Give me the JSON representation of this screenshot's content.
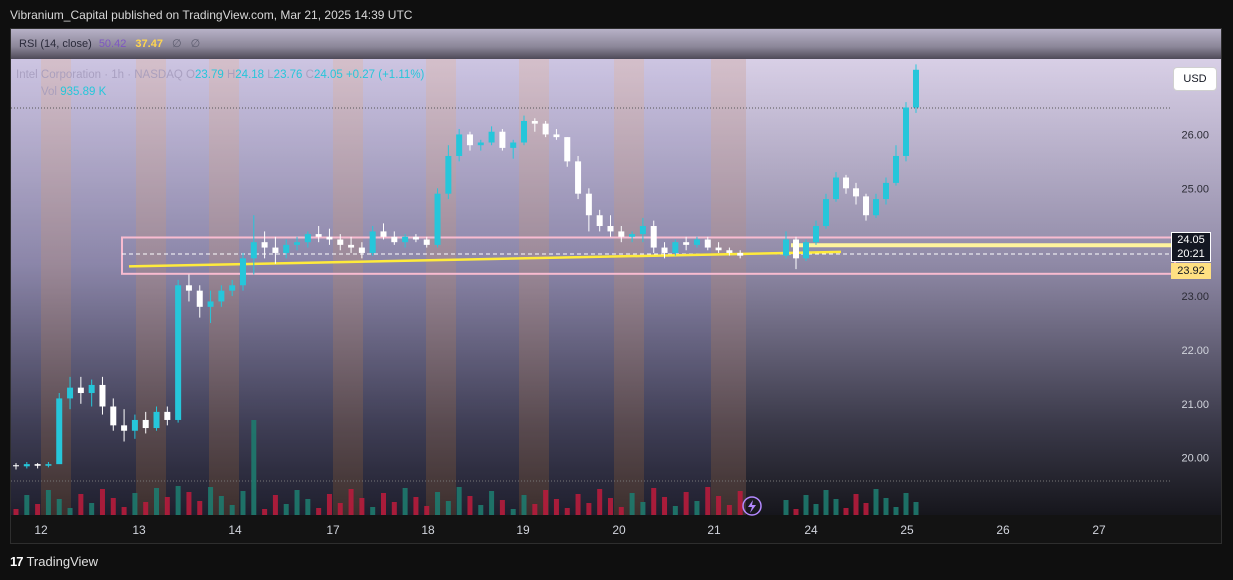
{
  "header": {
    "publisher_line": "Vibranium_Capital published on TradingView.com, Mar 21, 2025 14:39 UTC"
  },
  "rsi": {
    "name": "RSI (14, close)",
    "value1": "50.42",
    "value2": "37.47",
    "value3": "∅",
    "value4": "∅"
  },
  "legend": {
    "symbol": "Intel Corporation · 1h · NASDAQ",
    "o_label": "O",
    "o": "23.79",
    "h_label": "H",
    "h": "24.18",
    "l_label": "L",
    "l": "23.76",
    "c_label": "C",
    "c": "24.05",
    "change": "+0.27 (+1.11%)",
    "volume_label": "Vol",
    "volume": "935.89 K"
  },
  "currency_button": "USD",
  "badges": {
    "price": "24.05",
    "timer": "20:21",
    "level": "23.92"
  },
  "footer": {
    "brand": "TradingView",
    "logo": "17"
  },
  "colors": {
    "up": "#26c6da",
    "down": "#ffffff",
    "yellow": "#ffeb3b",
    "box": "#f8bbd0",
    "vol_up": "#1e7a6e",
    "vol_down": "#b71c3c"
  },
  "chart_data": {
    "type": "candlestick",
    "title": "Intel Corporation · 1h · NASDAQ",
    "y_ticks": [
      20.0,
      21.0,
      22.0,
      23.0,
      24.0,
      25.0,
      26.0
    ],
    "ylim": [
      19.4,
      27.4
    ],
    "x_ticks": [
      "12",
      "13",
      "14",
      "17",
      "18",
      "19",
      "20",
      "21",
      "24",
      "25",
      "26",
      "27"
    ],
    "last_price": 24.05,
    "levels": [
      24.05,
      23.92
    ],
    "candles": [
      [
        19.86,
        19.9,
        19.78,
        19.84
      ],
      [
        19.84,
        19.92,
        19.8,
        19.88
      ],
      [
        19.88,
        19.9,
        19.8,
        19.85
      ],
      [
        19.85,
        19.92,
        19.82,
        19.88
      ],
      [
        19.88,
        21.2,
        20.65,
        21.1
      ],
      [
        21.1,
        21.5,
        20.9,
        21.3
      ],
      [
        21.3,
        21.5,
        21.0,
        21.2
      ],
      [
        21.2,
        21.45,
        20.95,
        21.35
      ],
      [
        21.35,
        21.5,
        20.8,
        20.95
      ],
      [
        20.95,
        21.1,
        20.5,
        20.6
      ],
      [
        20.6,
        20.9,
        20.3,
        20.5
      ],
      [
        20.5,
        20.8,
        20.35,
        20.7
      ],
      [
        20.7,
        20.85,
        20.45,
        20.55
      ],
      [
        20.55,
        20.95,
        20.5,
        20.85
      ],
      [
        20.85,
        20.95,
        20.6,
        20.7
      ],
      [
        20.7,
        23.3,
        20.65,
        23.2
      ],
      [
        23.2,
        23.4,
        22.9,
        23.1
      ],
      [
        23.1,
        23.2,
        22.6,
        22.8
      ],
      [
        22.8,
        23.1,
        22.5,
        22.9
      ],
      [
        22.9,
        23.2,
        22.8,
        23.1
      ],
      [
        23.1,
        23.3,
        23.0,
        23.2
      ],
      [
        23.2,
        23.8,
        23.1,
        23.7
      ],
      [
        23.7,
        24.5,
        23.4,
        24.0
      ],
      [
        24.0,
        24.2,
        23.7,
        23.9
      ],
      [
        23.9,
        24.1,
        23.6,
        23.8
      ],
      [
        23.8,
        24.05,
        23.7,
        23.95
      ],
      [
        23.95,
        24.1,
        23.85,
        24.0
      ],
      [
        24.0,
        24.2,
        23.9,
        24.15
      ],
      [
        24.15,
        24.3,
        24.0,
        24.1
      ],
      [
        24.1,
        24.25,
        23.95,
        24.05
      ],
      [
        24.05,
        24.15,
        23.85,
        23.95
      ],
      [
        23.95,
        24.1,
        23.8,
        23.9
      ],
      [
        23.9,
        24.0,
        23.7,
        23.8
      ],
      [
        23.8,
        24.3,
        23.75,
        24.2
      ],
      [
        24.2,
        24.35,
        24.05,
        24.1
      ],
      [
        24.1,
        24.2,
        23.95,
        24.0
      ],
      [
        24.0,
        24.15,
        23.9,
        24.1
      ],
      [
        24.1,
        24.15,
        24.0,
        24.05
      ],
      [
        24.05,
        24.1,
        23.9,
        23.95
      ],
      [
        23.95,
        25.0,
        23.9,
        24.9
      ],
      [
        24.9,
        25.8,
        24.8,
        25.6
      ],
      [
        25.6,
        26.1,
        25.5,
        26.0
      ],
      [
        26.0,
        26.05,
        25.7,
        25.8
      ],
      [
        25.8,
        25.9,
        25.7,
        25.85
      ],
      [
        25.85,
        26.15,
        25.8,
        26.05
      ],
      [
        26.05,
        26.1,
        25.7,
        25.75
      ],
      [
        25.75,
        25.9,
        25.55,
        25.85
      ],
      [
        25.85,
        26.35,
        25.8,
        26.25
      ],
      [
        26.25,
        26.3,
        26.05,
        26.2
      ],
      [
        26.2,
        26.25,
        25.95,
        26.0
      ],
      [
        26.0,
        26.1,
        25.9,
        25.95
      ],
      [
        25.95,
        25.95,
        25.4,
        25.5
      ],
      [
        25.5,
        25.6,
        24.8,
        24.9
      ],
      [
        24.9,
        25.0,
        24.2,
        24.5
      ],
      [
        24.5,
        24.6,
        24.2,
        24.3
      ],
      [
        24.3,
        24.5,
        24.1,
        24.2
      ],
      [
        24.2,
        24.3,
        24.0,
        24.1
      ],
      [
        24.1,
        24.2,
        24.0,
        24.15
      ],
      [
        24.15,
        24.45,
        24.0,
        24.3
      ],
      [
        24.3,
        24.4,
        23.8,
        23.9
      ],
      [
        23.9,
        24.0,
        23.7,
        23.8
      ],
      [
        23.8,
        24.05,
        23.75,
        24.0
      ],
      [
        24.0,
        24.1,
        23.85,
        23.95
      ],
      [
        23.95,
        24.1,
        23.9,
        24.05
      ],
      [
        24.05,
        24.1,
        23.85,
        23.9
      ],
      [
        23.9,
        24.0,
        23.8,
        23.85
      ],
      [
        23.85,
        23.9,
        23.75,
        23.8
      ],
      [
        23.8,
        23.85,
        23.7,
        23.75
      ],
      [
        23.75,
        24.2,
        23.7,
        24.05
      ],
      [
        24.05,
        24.1,
        23.5,
        23.7
      ],
      [
        23.7,
        24.05,
        23.65,
        24.0
      ],
      [
        24.0,
        24.4,
        23.95,
        24.3
      ],
      [
        24.3,
        24.9,
        24.25,
        24.8
      ],
      [
        24.8,
        25.3,
        24.75,
        25.2
      ],
      [
        25.2,
        25.25,
        24.9,
        25.0
      ],
      [
        25.0,
        25.1,
        24.7,
        24.85
      ],
      [
        24.85,
        24.9,
        24.4,
        24.5
      ],
      [
        24.5,
        24.9,
        24.45,
        24.8
      ],
      [
        24.8,
        25.2,
        24.7,
        25.1
      ],
      [
        25.1,
        25.8,
        25.05,
        25.6
      ],
      [
        25.6,
        26.6,
        25.5,
        26.5
      ],
      [
        26.5,
        27.3,
        26.4,
        27.2
      ]
    ]
  }
}
